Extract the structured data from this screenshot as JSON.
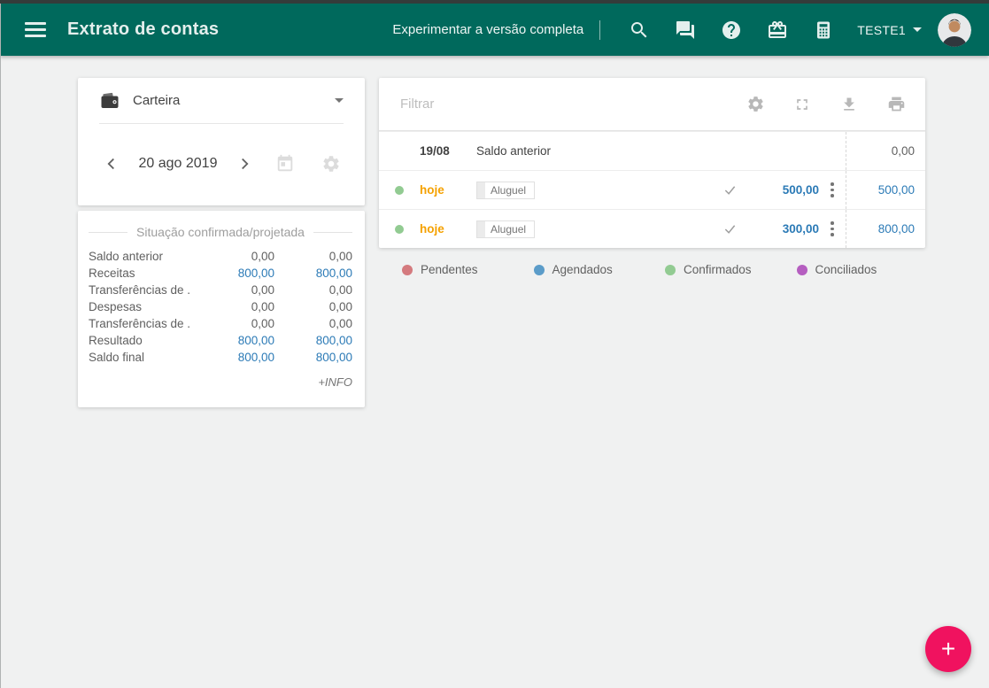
{
  "window": {
    "chrome_color": "#343b3a"
  },
  "header": {
    "bg": "#00695c",
    "title": "Extrato de contas",
    "promo_label": "Experimentar a versão completa",
    "account_name": "TESTE1",
    "icons": [
      "menu-icon",
      "search-icon",
      "chat-icon",
      "help-icon",
      "gift-icon",
      "calculator-icon",
      "avatar"
    ]
  },
  "account_card": {
    "account_label": "Carteira",
    "date_label": "20 ago 2019",
    "icons": [
      "wallet-icon",
      "chevron-left-icon",
      "chevron-right-icon",
      "calendar-icon",
      "gear-icon"
    ]
  },
  "summary_card": {
    "title": "Situação confirmada/projetada",
    "more_label": "+INFO",
    "rows": [
      {
        "label": "Saldo anterior",
        "confirmed": "0,00",
        "projected": "0,00",
        "highlight": false
      },
      {
        "label": "Receitas",
        "confirmed": "800,00",
        "projected": "800,00",
        "highlight": true
      },
      {
        "label": "Transferências de ...",
        "confirmed": "0,00",
        "projected": "0,00",
        "highlight": false
      },
      {
        "label": "Despesas",
        "confirmed": "0,00",
        "projected": "0,00",
        "highlight": false
      },
      {
        "label": "Transferências de ...",
        "confirmed": "0,00",
        "projected": "0,00",
        "highlight": false
      },
      {
        "label": "Resultado",
        "confirmed": "800,00",
        "projected": "800,00",
        "highlight": true
      },
      {
        "label": "Saldo final",
        "confirmed": "800,00",
        "projected": "800,00",
        "highlight": true
      }
    ]
  },
  "transactions": {
    "filter_placeholder": "Filtrar",
    "toolbar_icons": [
      "gear-icon",
      "fullscreen-icon",
      "download-icon",
      "print-icon"
    ],
    "balance_row": {
      "date": "19/08",
      "description": "Saldo anterior",
      "balance": "0,00"
    },
    "rows": [
      {
        "date": "hoje",
        "tag": "Aluguel",
        "amount": "500,00",
        "balance": "500,00",
        "status": "confirmado",
        "status_color": "#92cb92"
      },
      {
        "date": "hoje",
        "tag": "Aluguel",
        "amount": "300,00",
        "balance": "800,00",
        "status": "confirmado",
        "status_color": "#92cb92"
      }
    ]
  },
  "legend": [
    {
      "label": "Pendentes",
      "color": "#d47a7e"
    },
    {
      "label": "Agendados",
      "color": "#5b9cc9"
    },
    {
      "label": "Confirmados",
      "color": "#92cb92"
    },
    {
      "label": "Conciliados",
      "color": "#b55ec0"
    }
  ],
  "fab": {
    "label": "+",
    "color": "#f0125f"
  },
  "colors": {
    "amount_blue": "#2b7ab6",
    "date_orange": "#f5a100",
    "header_green": "#00695c"
  }
}
